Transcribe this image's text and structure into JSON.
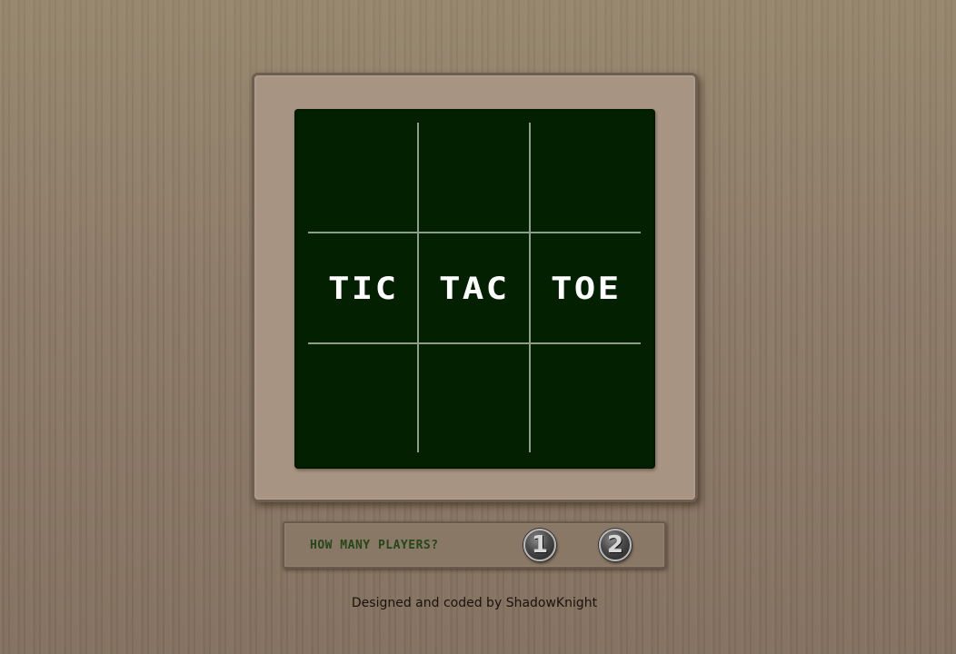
{
  "board": {
    "cells": [
      "",
      "",
      "",
      "TIC",
      "TAC",
      "TOE",
      "",
      "",
      ""
    ]
  },
  "players": {
    "prompt": "HOW MANY PLAYERS?",
    "one_label": "1",
    "two_label": "2"
  },
  "footer": {
    "credit_prefix": "Designed and coded by",
    "author": "ShadowKnight"
  },
  "colors": {
    "board": "#032101",
    "frame": "#a89482",
    "prompt": "#24471a"
  }
}
